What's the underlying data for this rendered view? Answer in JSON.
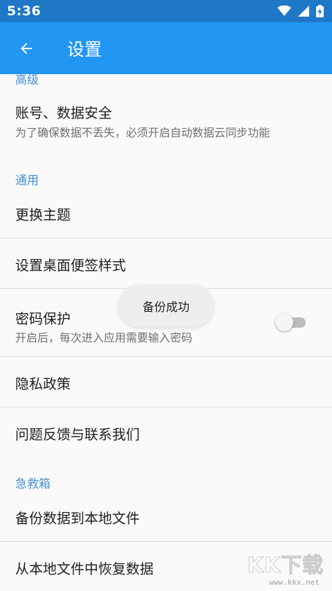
{
  "status_bar": {
    "time": "5:36"
  },
  "app_bar": {
    "title": "设置"
  },
  "sections": {
    "advanced": "高级",
    "general": "通用",
    "first_aid": "急救箱"
  },
  "items": {
    "account": {
      "title": "账号、数据安全",
      "subtitle": "为了确保数据不丢失，必须开启自动数据云同步功能"
    },
    "theme": {
      "title": "更换主题"
    },
    "widget_style": {
      "title": "设置桌面便签样式"
    },
    "password": {
      "title": "密码保护",
      "subtitle": "开启后，每次进入应用需要输入密码",
      "enabled": false
    },
    "privacy": {
      "title": "隐私政策"
    },
    "feedback": {
      "title": "问题反馈与联系我们"
    },
    "backup": {
      "title": "备份数据到本地文件"
    },
    "restore": {
      "title": "从本地文件中恢复数据"
    }
  },
  "toast": {
    "text": "备份成功"
  },
  "watermark": {
    "main": "KK下载",
    "url": "www.kkx.net"
  },
  "colors": {
    "status_bar": "#1e78c6",
    "app_bar": "#2196f3",
    "section_header": "#4a90d9"
  }
}
